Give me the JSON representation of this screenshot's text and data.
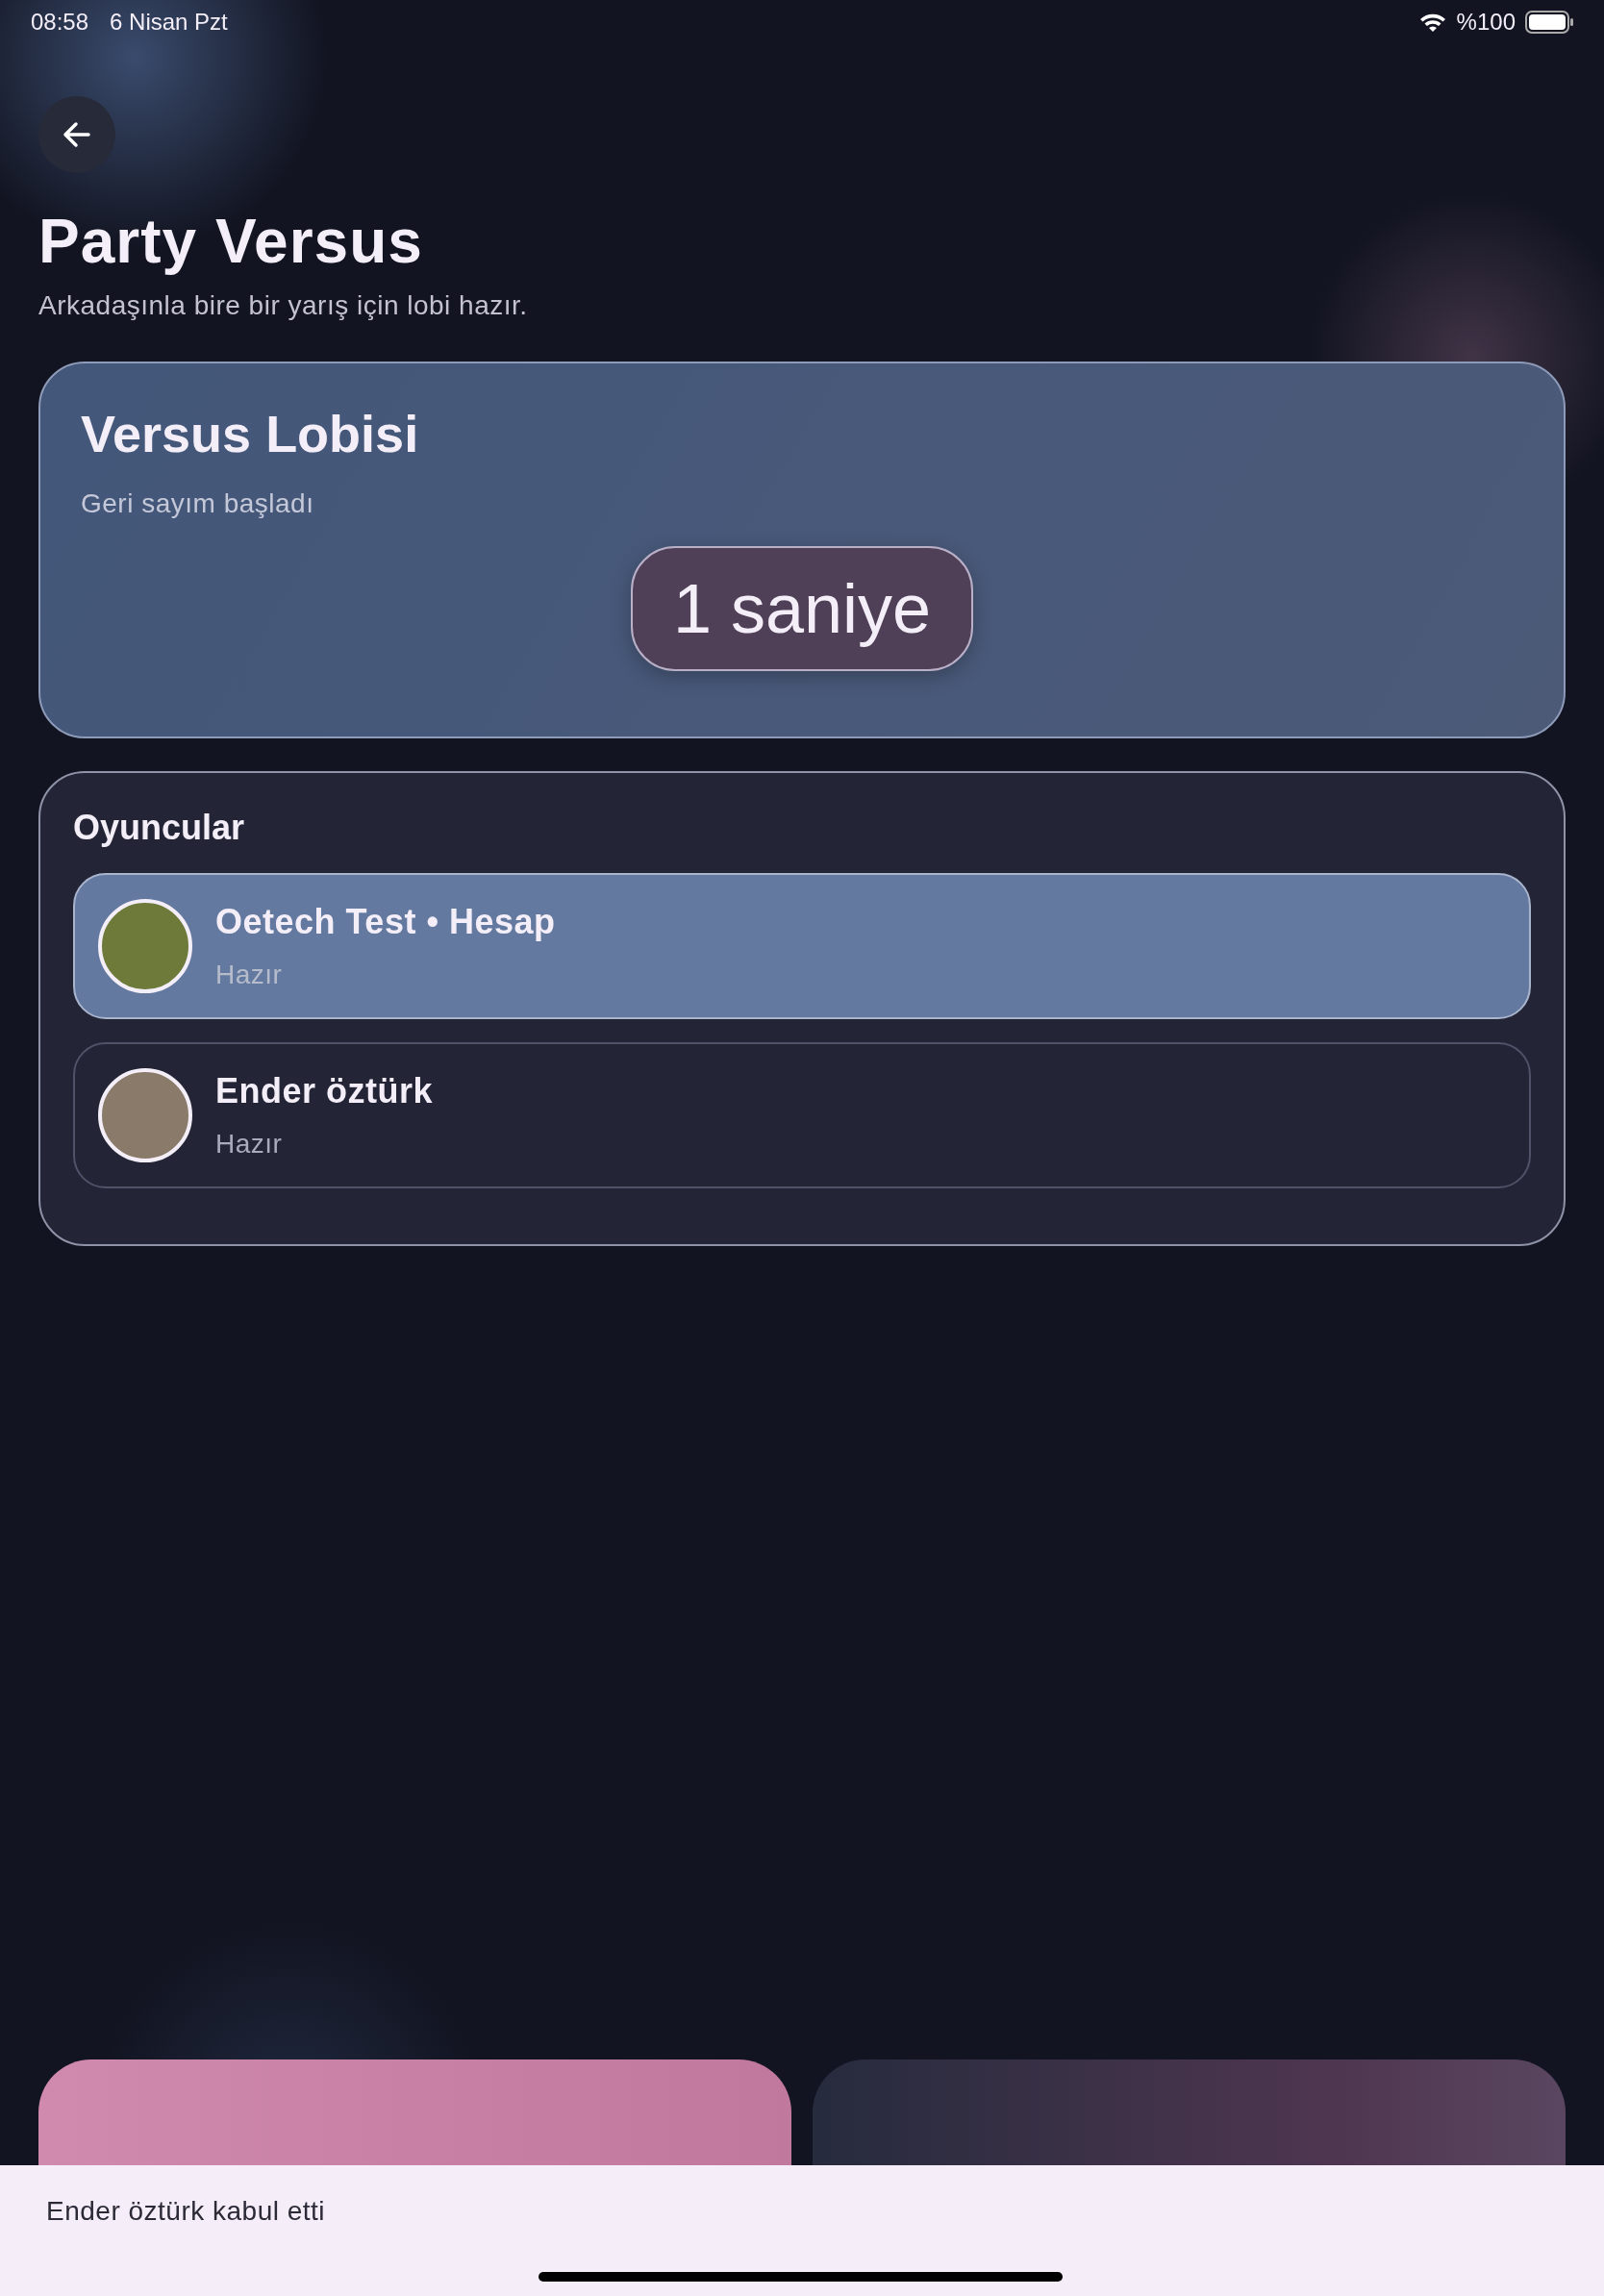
{
  "status_bar": {
    "time": "08:58",
    "date": "6 Nisan Pzt",
    "battery": "%100"
  },
  "header": {
    "title": "Party Versus",
    "subtitle": "Arkadaşınla bire bir yarış için lobi hazır."
  },
  "lobby": {
    "title": "Versus Lobisi",
    "status": "Geri sayım başladı",
    "countdown": "1 saniye"
  },
  "players": {
    "title": "Oyuncular",
    "items": [
      {
        "name": "Oetech Test • Hesap",
        "status": "Hazır",
        "selected": true
      },
      {
        "name": "Ender öztürk",
        "status": "Hazır",
        "selected": false
      }
    ]
  },
  "actions": [
    {
      "kind": "primary"
    },
    {
      "kind": "secondary"
    }
  ],
  "snackbar": {
    "message": "Ender öztürk kabul etti"
  }
}
